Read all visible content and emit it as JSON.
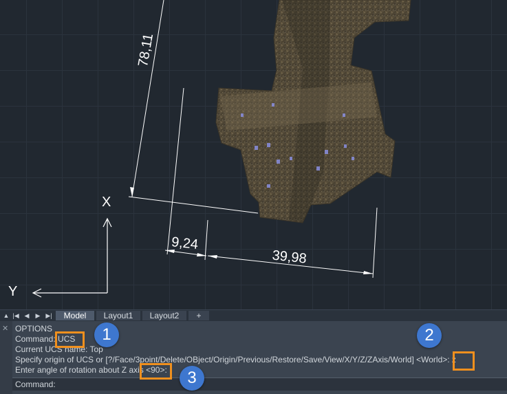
{
  "drawing": {
    "dim_vertical": "78,11",
    "dim_short": "9,24",
    "dim_long": "39,98",
    "ucs_x_label": "X",
    "ucs_y_label": "Y"
  },
  "layout_tabs": {
    "nav": [
      "▲",
      "|◀",
      "◀",
      "▶",
      "▶|"
    ],
    "tabs": [
      "Model",
      "Layout1",
      "Layout2",
      "+"
    ],
    "active": "Model"
  },
  "command_line": {
    "close_icon": "✕",
    "history": [
      "OPTIONS",
      "Command: UCS",
      "Current UCS name:  Top",
      "Specify origin of UCS or [?/Face/3point/Delete/OBject/Origin/Previous/Restore/Save/View/X/Y/Z/ZAxis/World] <World>: z",
      "Enter angle of rotation about Z axis <90>:"
    ],
    "prompt": "Command:",
    "input_value": "",
    "input_placeholder": ""
  },
  "annotations": {
    "badge_1": "1",
    "badge_2": "2",
    "badge_3": "3",
    "highlight_color": "#f0901e",
    "badge_color": "#3e77cf"
  }
}
